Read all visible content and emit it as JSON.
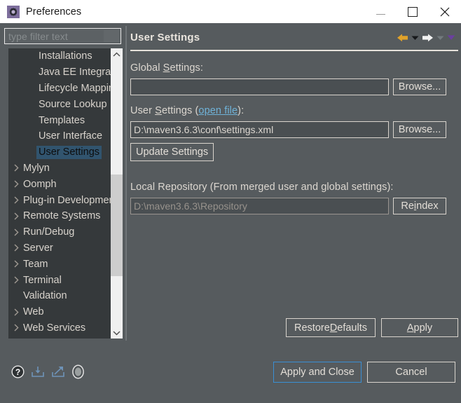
{
  "window": {
    "title": "Preferences",
    "app_icon": "gear-icon",
    "controls": {
      "minimize": "minimize-icon",
      "maximize": "maximize-icon",
      "close": "close-icon"
    }
  },
  "sidebar": {
    "filter": {
      "value": "",
      "placeholder": "type filter text"
    },
    "tree": [
      {
        "label": "Installations",
        "indent": true,
        "expandable": false,
        "selected": false
      },
      {
        "label": "Java EE Integration",
        "indent": true,
        "expandable": false,
        "selected": false
      },
      {
        "label": "Lifecycle Mappings",
        "indent": true,
        "expandable": false,
        "selected": false
      },
      {
        "label": "Source Lookup",
        "indent": true,
        "expandable": false,
        "selected": false
      },
      {
        "label": "Templates",
        "indent": true,
        "expandable": false,
        "selected": false
      },
      {
        "label": "User Interface",
        "indent": true,
        "expandable": false,
        "selected": false
      },
      {
        "label": "User Settings",
        "indent": true,
        "expandable": false,
        "selected": true
      },
      {
        "label": "Mylyn",
        "indent": false,
        "expandable": true,
        "selected": false
      },
      {
        "label": "Oomph",
        "indent": false,
        "expandable": true,
        "selected": false
      },
      {
        "label": "Plug-in Development",
        "indent": false,
        "expandable": true,
        "selected": false
      },
      {
        "label": "Remote Systems",
        "indent": false,
        "expandable": true,
        "selected": false
      },
      {
        "label": "Run/Debug",
        "indent": false,
        "expandable": true,
        "selected": false
      },
      {
        "label": "Server",
        "indent": false,
        "expandable": true,
        "selected": false
      },
      {
        "label": "Team",
        "indent": false,
        "expandable": true,
        "selected": false
      },
      {
        "label": "Terminal",
        "indent": false,
        "expandable": true,
        "selected": false
      },
      {
        "label": "Validation",
        "indent": false,
        "expandable": false,
        "selected": false
      },
      {
        "label": "Web",
        "indent": false,
        "expandable": true,
        "selected": false
      },
      {
        "label": "Web Services",
        "indent": false,
        "expandable": true,
        "selected": false
      }
    ],
    "vscrollbar": {
      "up_icon": "chevron-up-icon",
      "down_icon": "chevron-down-icon",
      "thumb_top_pct": 43,
      "thumb_height_pct": 38
    },
    "hscrollbar": {
      "left_icon": "chevron-left-icon",
      "right_icon": "chevron-right-icon",
      "thumb_left_pct": 2,
      "thumb_width_pct": 42
    }
  },
  "panel": {
    "title": "User Settings",
    "nav": {
      "back_icon": "back-arrow-icon",
      "back_menu_icon": "chevron-down-icon",
      "forward_icon": "forward-arrow-icon",
      "forward_menu_icon": "chevron-down-icon",
      "view_menu_icon": "chevron-down-icon"
    },
    "global_settings": {
      "label_before": "Global ",
      "label_accel": "S",
      "label_after": "ettings:",
      "value": "",
      "placeholder": "",
      "browse_label": "Browse..."
    },
    "user_settings": {
      "label_before": "User ",
      "label_accel": "S",
      "label_mid": "ettings (",
      "link_label": "open file",
      "label_after": "):",
      "value": "D:\\maven3.6.3\\conf\\settings.xml",
      "browse_label": "Browse...",
      "update_label": "Update Settings"
    },
    "local_repository": {
      "label": "Local Repository (From merged user and global settings):",
      "value": "D:\\maven3.6.3\\Repository",
      "reindex_before": "Re",
      "reindex_accel": "i",
      "reindex_after": "ndex"
    },
    "footer": {
      "restore_before": "Restore ",
      "restore_accel": "D",
      "restore_after": "efaults",
      "apply_accel": "A",
      "apply_after": "pply"
    }
  },
  "bottombar": {
    "icons": [
      {
        "name": "help-icon"
      },
      {
        "name": "import-icon"
      },
      {
        "name": "export-icon"
      },
      {
        "name": "oomph-recorder-icon"
      }
    ],
    "apply_and_close_label": "Apply and Close",
    "cancel_label": "Cancel"
  },
  "colors": {
    "window_bg": "#565b5e",
    "titlebar_bg": "#ffffff",
    "tree_bg": "#35393b",
    "selection_bg": "#31546e",
    "accent_link": "#6fb3d9",
    "focus_border": "#3a8fd4",
    "back_arrow": "#e0a22a",
    "forward_arrow": "#ffffff",
    "menu_arrow_purple": "#6b3fa0",
    "app_icon_bg": "#7d6e9c"
  }
}
